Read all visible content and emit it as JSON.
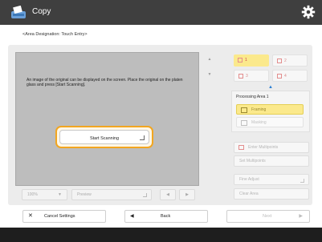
{
  "header": {
    "title": "Copy",
    "app_icon": "copy-app-icon",
    "settings_icon": "gear-icon"
  },
  "subtitle": "<Area Designation: Touch Entry>",
  "preview": {
    "message": "An image of the original can be displayed on the screen. Place the original on the platen glass and press [Start Scanning].",
    "scan_button": "Start Scanning"
  },
  "bottom_controls": {
    "zoom_value": "100%",
    "preview_label": "Preview"
  },
  "areas": [
    {
      "label": "1",
      "selected": true
    },
    {
      "label": "2",
      "selected": false
    },
    {
      "label": "3",
      "selected": false
    },
    {
      "label": "4",
      "selected": false
    }
  ],
  "processing_area": {
    "title": "Processing Area 1",
    "options": [
      {
        "label": "Framing",
        "selected": true
      },
      {
        "label": "Masking",
        "selected": false
      }
    ]
  },
  "right_buttons": [
    {
      "label": "Enter Multipoints"
    },
    {
      "label": "Set Multipoints"
    },
    {
      "label": "Fine Adjust"
    },
    {
      "label": "Clear Area"
    }
  ],
  "footer_buttons": {
    "cancel": "Cancel Settings",
    "back": "Back",
    "next": "Next"
  },
  "colors": {
    "topbar": "#3f3f3f",
    "accent_orange": "#f2a620",
    "selected_yellow": "#fbe98c",
    "area_red": "#d94a4a",
    "arrow_blue": "#2a7fd4"
  }
}
